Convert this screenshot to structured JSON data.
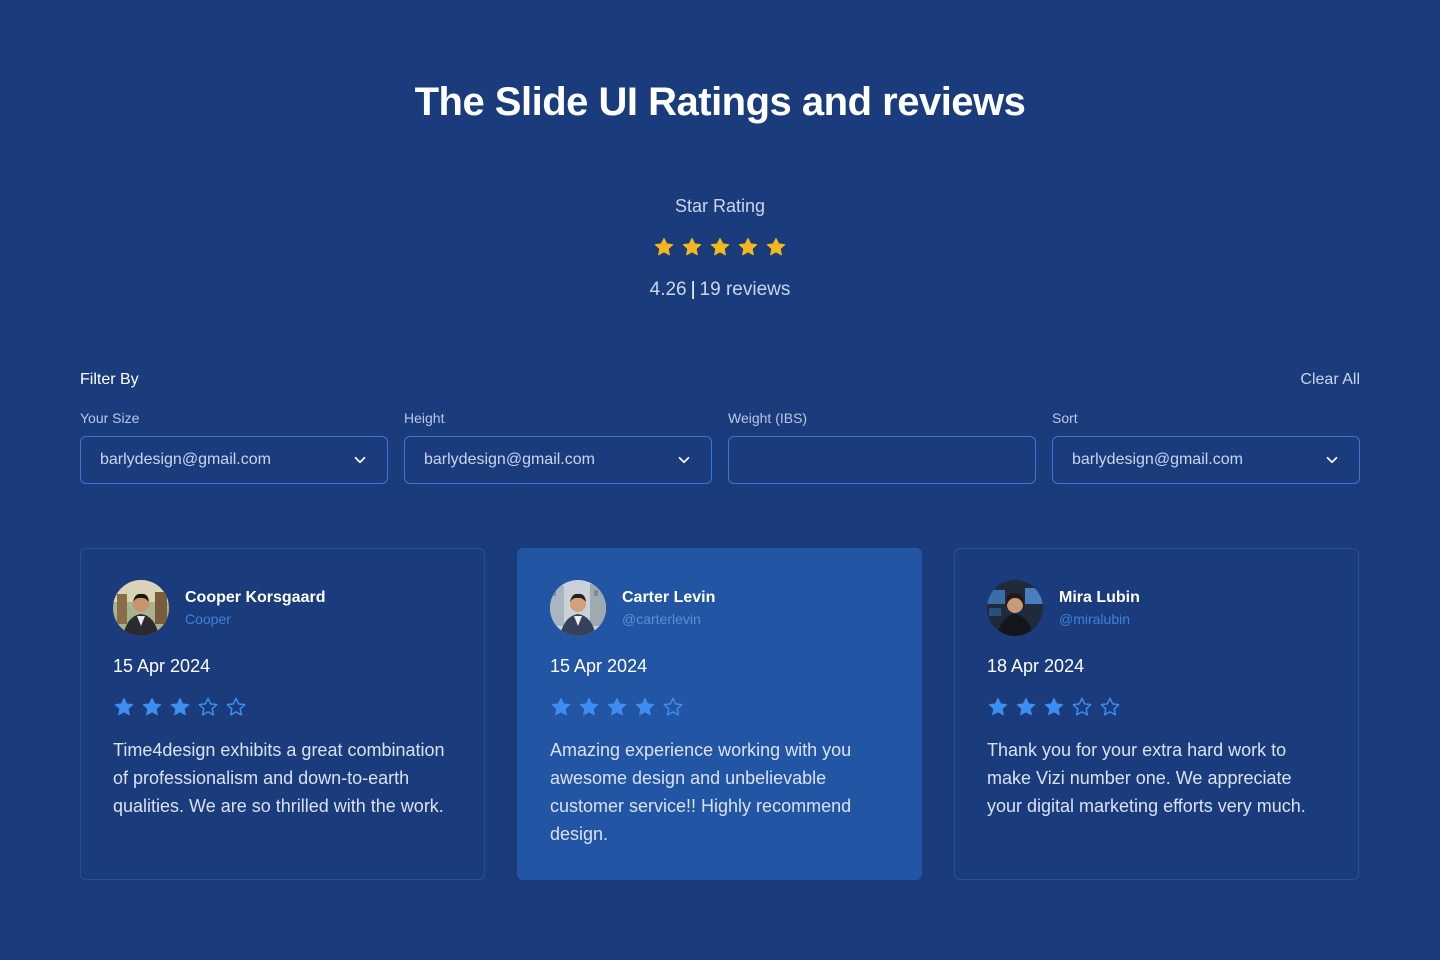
{
  "page": {
    "title": "The Slide UI Ratings and reviews"
  },
  "summary": {
    "label": "Star Rating",
    "stars": 5,
    "average": "4.26",
    "separator": "|",
    "count_text": "19 reviews"
  },
  "filters": {
    "heading": "Filter By",
    "clear_label": "Clear All",
    "fields": [
      {
        "label": "Your Size",
        "value": "barlydesign@gmail.com",
        "type": "select"
      },
      {
        "label": "Height",
        "value": "barlydesign@gmail.com",
        "type": "select"
      },
      {
        "label": "Weight (IBS)",
        "value": "",
        "type": "input"
      },
      {
        "label": "Sort",
        "value": "barlydesign@gmail.com",
        "type": "select"
      }
    ]
  },
  "reviews": [
    {
      "name": "Cooper Korsgaard",
      "handle": "Cooper",
      "date": "15 Apr 2024",
      "rating": 3,
      "text": "Time4design exhibits a great combination of professionalism and down-to-earth qualities. We are so thrilled with the work."
    },
    {
      "name": "Carter Levin",
      "handle": "@carterlevin",
      "date": "15 Apr 2024",
      "rating": 4,
      "text": "Amazing experience working with you awesome design and unbelievable customer service!! Highly recommend design."
    },
    {
      "name": "Mira Lubin",
      "handle": "@miralubin",
      "date": "18 Apr 2024",
      "rating": 3,
      "text": "Thank you for your extra hard work to make Vizi number one. We appreciate your digital marketing efforts very much."
    }
  ],
  "colors": {
    "background": "#1a3c7c",
    "active_card": "#2355a5",
    "summary_star": "#f5b81c",
    "review_star": "#3d8ef0",
    "border": "#3d74d4"
  }
}
